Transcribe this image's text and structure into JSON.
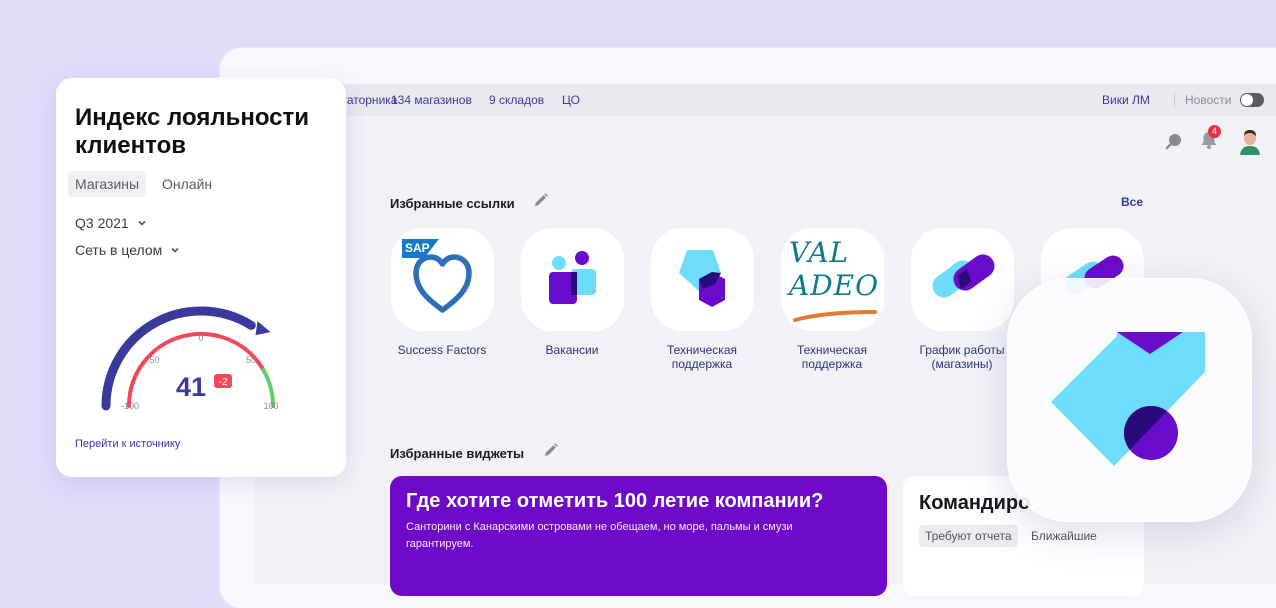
{
  "topbar": {
    "nav": [
      "игаторника",
      "134 магазинов",
      "9 складов",
      "ЦО"
    ],
    "wiki": "Вики ЛМ",
    "news_label": "Новости"
  },
  "header": {
    "notification_count": "4",
    "icons": [
      "search-icon",
      "bell-icon",
      "avatar"
    ]
  },
  "favorites": {
    "title": "Избранные ссылки",
    "all_label": "Все",
    "tiles": [
      {
        "label": "Success Factors",
        "logo_text": "SAP"
      },
      {
        "label": "Вакансии"
      },
      {
        "label_line1": "Техническая",
        "label_line2": "поддержка"
      },
      {
        "label_line1": "Техническая",
        "label_line2": "поддержка",
        "logo_line1": "VAL",
        "logo_line2": "ADEO"
      },
      {
        "label_line1": "График работы",
        "label_line2": "(магазины)"
      }
    ]
  },
  "widgets": {
    "title": "Избранные виджеты",
    "promo": {
      "title": "Где хотите отметить 100 летие компании?",
      "text": "Санторини с Канарскими островами не обещаем, но море, пальмы и смузи гарантируем."
    },
    "trip": {
      "title": "Командиро",
      "tab_active": "Требуют отчета",
      "tab_other": "Ближайшие"
    }
  },
  "loyalty": {
    "title": "Индекс лояльности клиентов",
    "tab_active": "Магазины",
    "tab_other": "Онлайн",
    "period": "Q3 2021",
    "scope": "Сеть в целом",
    "value": "41",
    "delta": "-2",
    "gauge_min": -100,
    "gauge_max": 100,
    "ticks": [
      "-100",
      "-50",
      "0",
      "50",
      "100"
    ],
    "link": "Перейти к источнику"
  },
  "colors": {
    "accent": "#6e0ac8",
    "link": "#3437a8",
    "gauge_blue": "#3a3a9c",
    "gauge_red": "#f0485a",
    "gauge_green": "#5fd068",
    "tile_cyan": "#6edcfd",
    "tile_purple": "#6a0ccb",
    "tile_dark": "#2a0a7a"
  }
}
